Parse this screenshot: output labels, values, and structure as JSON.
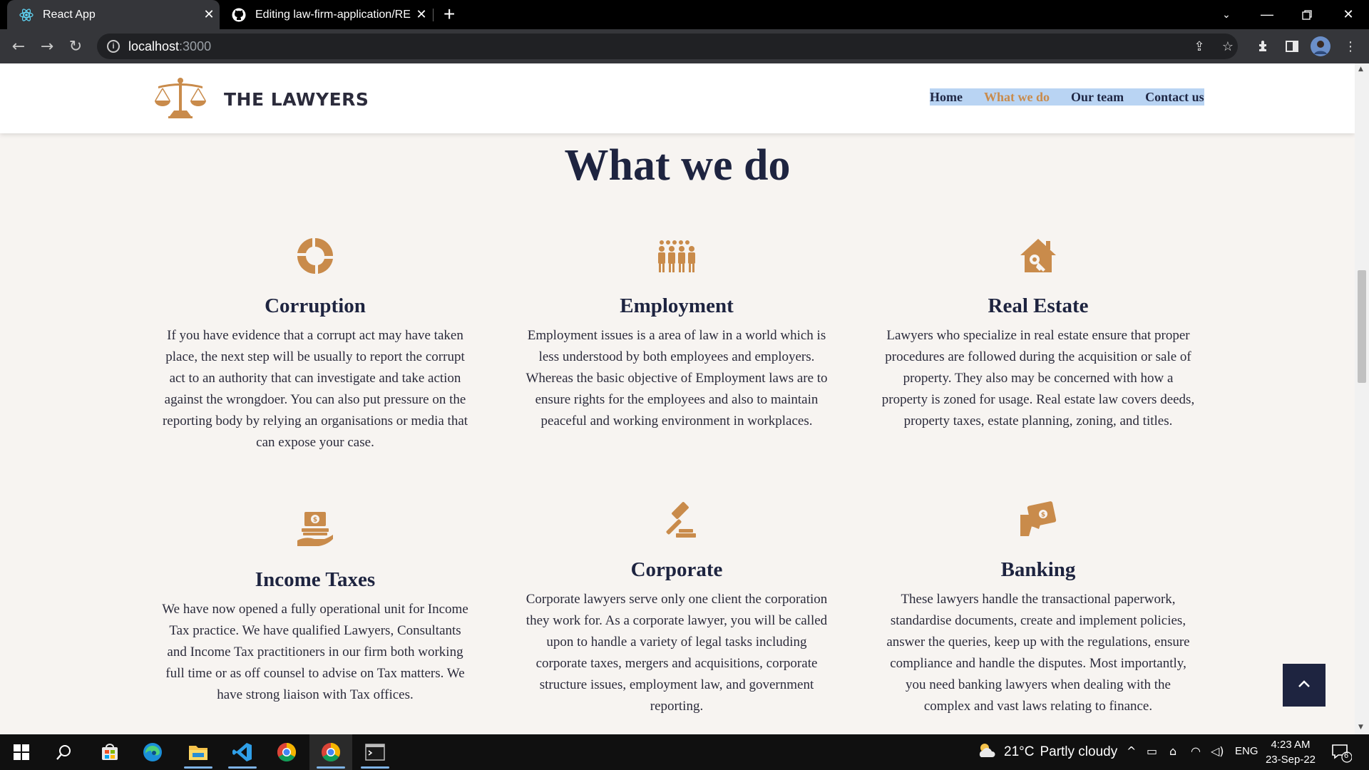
{
  "browser": {
    "tabs": [
      {
        "title": "React App",
        "icon": "react-icon",
        "active": true
      },
      {
        "title": "Editing law-firm-application/README",
        "icon": "github-icon",
        "active": false
      }
    ],
    "url_host": "localhost",
    "url_port": ":3000"
  },
  "site": {
    "brand": "THE LAWYERS",
    "nav": [
      {
        "label": "Home",
        "active": false
      },
      {
        "label": "What we do",
        "active": true
      },
      {
        "label": "Our team",
        "active": false
      },
      {
        "label": "Contact us",
        "active": false
      }
    ],
    "section_title": "What we do",
    "services": [
      {
        "title": "Corruption",
        "icon": "corruption-icon",
        "text": "If you have evidence that a corrupt act may have taken place, the next step will be usually to report the corrupt act to an authority that can investigate and take action against the wrongdoer. You can also put pressure on the reporting body by relying an organisations or media that can expose your case."
      },
      {
        "title": "Employment",
        "icon": "employees-icon",
        "text": "Employment issues is a area of law in a world which is less understood by both employees and employers. Whereas the basic objective of Employment laws are to ensure rights for the employees and also to maintain peaceful and working environment in workplaces."
      },
      {
        "title": "Real Estate",
        "icon": "house-key-icon",
        "text": "Lawyers who specialize in real estate ensure that proper procedures are followed during the acquisition or sale of property. They also may be concerned with how a property is zoned for usage. Real estate law covers deeds, property taxes, estate planning, zoning, and titles."
      },
      {
        "title": "Income Taxes",
        "icon": "money-hand-icon",
        "text": "We have now opened a fully operational unit for Income Tax practice. We have qualified Lawyers, Consultants and Income Tax practitioners in our firm both working full time or as off counsel to advise on Tax matters. We have strong liaison with Tax offices."
      },
      {
        "title": "Corporate",
        "icon": "gavel-icon",
        "text": "Corporate lawyers serve only one client the corporation they work for. As a corporate lawyer, you will be called upon to handle a variety of legal tasks including corporate taxes, mergers and acquisitions, corporate structure issues, employment law, and government reporting."
      },
      {
        "title": "Banking",
        "icon": "cash-hand-icon",
        "text": "These lawyers handle the transactional paperwork, standardise documents, create and implement policies, answer the queries, keep up with the regulations, ensure compliance and handle the disputes. Most importantly, you need banking lawyers when dealing with the complex and vast laws relating to finance."
      }
    ]
  },
  "taskbar": {
    "weather_temp": "21°C",
    "weather_desc": "Partly cloudy",
    "lang": "ENG",
    "time": "4:23 AM",
    "date": "23-Sep-22",
    "notif_count": "6"
  },
  "colors": {
    "accent": "#c98b4b",
    "navy": "#1e2440",
    "page_bg": "#f7f4f1"
  }
}
